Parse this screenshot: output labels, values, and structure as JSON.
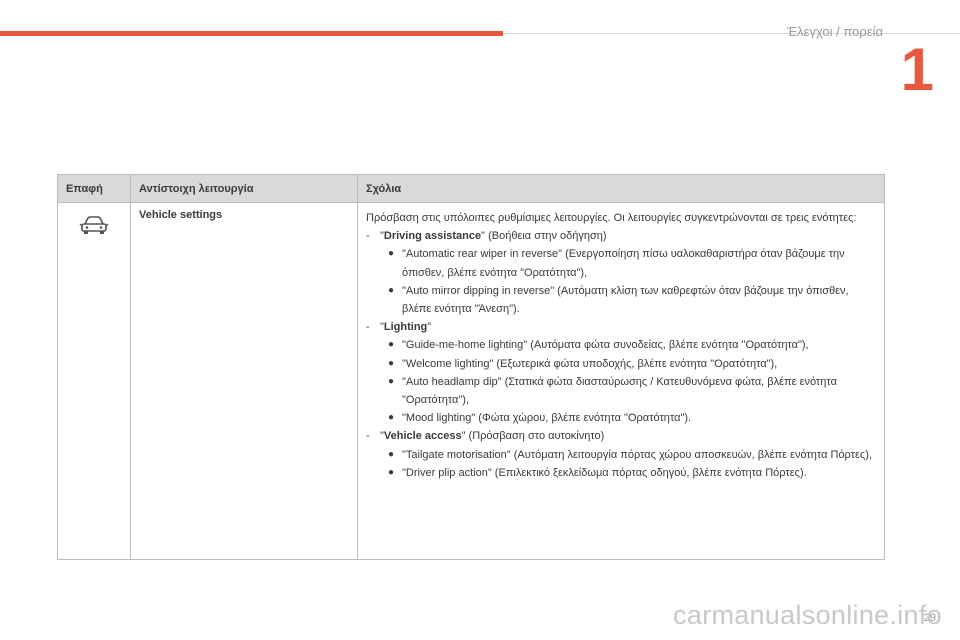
{
  "header": {
    "chapter_title": "Έλεγχοι / πορεία",
    "chapter_number": "1"
  },
  "table": {
    "columns": [
      "Επαφή",
      "Αντίστοιχη λειτουργία",
      "Σχόλια"
    ],
    "row": {
      "icon": "car-front-icon",
      "function": "Vehicle settings",
      "intro": "Πρόσβαση στις υπόλοιπες ρυθμίσιμες λειτουργίες. Οι λειτουργίες συγκεντρώνονται σε τρεις ενότητες:",
      "sections": [
        {
          "dash": "-",
          "quote_open": "\"",
          "name": "Driving assistance",
          "rest": "\" (Βοήθεια στην οδήγηση)",
          "bullets": [
            "\"Automatic rear wiper in reverse\" (Ενεργοποίηση πίσω υαλοκαθαριστήρα όταν βάζουμε την όπισθεν, βλέπε ενότητα \"Ορατότητα\"),",
            "\"Auto mirror dipping in reverse\" (Αυτόματη κλίση των καθρεφτών όταν βάζουμε την όπισθεν, βλέπε ενότητα \"Άνεση\")."
          ]
        },
        {
          "dash": "-",
          "quote_open": "\"",
          "name": "Lighting",
          "rest": "\"",
          "bullets": [
            "\"Guide-me-home lighting\" (Αυτόματα φώτα συνοδείας, βλέπε ενότητα \"Ορατότητα\"),",
            "\"Welcome lighting\" (Εξωτερικά φώτα υποδοχής, βλέπε ενότητα \"Ορατότητα\"),",
            "\"Auto headlamp dip\" (Στατικά φώτα διασταύρωσης / Κατευθυνόμενα φώτα, βλέπε ενότητα \"Ορατότητα\"),",
            "\"Mood lighting\" (Φώτα χώρου, βλέπε ενότητα \"Ορατότητα\")."
          ]
        },
        {
          "dash": "-",
          "quote_open": "\"",
          "name": "Vehicle access",
          "rest": "\" (Πρόσβαση στο αυτοκίνητο)",
          "bullets": [
            "\"Tailgate motorisation\" (Αυτόματη λειτουργία πόρτας χώρου αποσκευών, βλέπε ενότητα Πόρτες),",
            "\"Driver plip action\" (Επιλεκτικό ξεκλείδωμα πόρτας οδηγού, βλέπε ενότητα Πόρτες)."
          ]
        }
      ]
    }
  },
  "footer": {
    "page_number": "29",
    "watermark": "carmanualsonline.info"
  },
  "colors": {
    "accent": "#e8583e",
    "header_bg": "#d9d9d9"
  }
}
